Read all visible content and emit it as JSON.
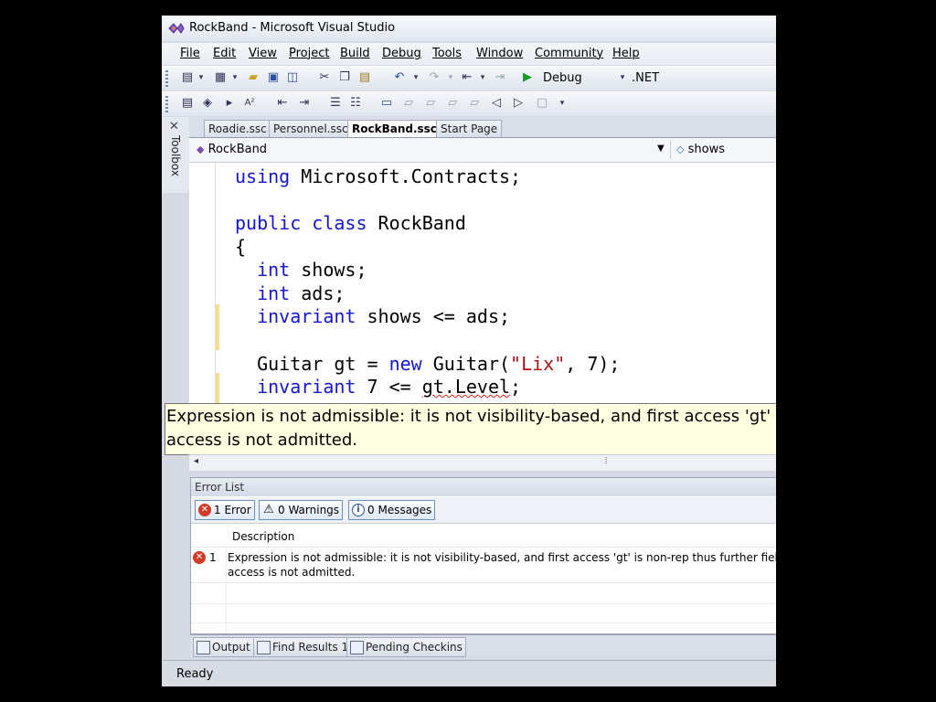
{
  "window": {
    "title": "RockBand - Microsoft Visual Studio"
  },
  "menu": [
    "File",
    "Edit",
    "View",
    "Project",
    "Build",
    "Debug",
    "Tools",
    "Window",
    "Community",
    "Help"
  ],
  "toolbar": {
    "config": "Debug",
    "platform": ".NET"
  },
  "sidebar": {
    "toolbox_label": "Toolbox"
  },
  "tabs": [
    {
      "label": "Roadie.ssc"
    },
    {
      "label": "Personnel.ssc"
    },
    {
      "label": "RockBand.ssc*",
      "active": true
    },
    {
      "label": "Start Page"
    }
  ],
  "navbar": {
    "type_combo": "RockBand",
    "member_combo": "shows"
  },
  "code": {
    "l1_kw": "using",
    "l1_rest": " Microsoft.Contracts;",
    "l2_kw1": "public",
    "l2_kw2": "class",
    "l2_rest": " RockBand",
    "l3": "{",
    "l4_kw": "int",
    "l4_rest": " shows;",
    "l5_kw": "int",
    "l5_rest": " ads;",
    "l6_kw": "invariant",
    "l6_rest": " shows <= ads;",
    "l7_a": "Guitar gt = ",
    "l7_kw": "new",
    "l7_b": " Guitar(",
    "l7_str": "\"Lix\"",
    "l7_c": ", 7);",
    "l8_kw": "invariant",
    "l8_a": " 7 <= ",
    "l8_err": "gt.Level",
    "l8_b": ";"
  },
  "tooltip": {
    "line1": "Expression is not admissible: it is not visibility-based, and first access 'gt' is",
    "line2": "access is not admitted."
  },
  "error_list": {
    "title": "Error List",
    "errors_btn": "1 Error",
    "warnings_btn": "0 Warnings",
    "messages_btn": "0 Messages",
    "col_description": "Description",
    "rows": [
      {
        "num": "1",
        "line1": "Expression is not admissible: it is not visibility-based, and first access 'gt' is non-rep thus further field",
        "line2": "access is not admitted."
      }
    ]
  },
  "bottom_tabs": [
    "Output",
    "Find Results 1",
    "Pending Checkins"
  ],
  "status": {
    "text": "Ready"
  },
  "colors": {
    "keyword": "#1515d0",
    "string": "#a31515",
    "tooltip_bg": "#ffffe1"
  }
}
